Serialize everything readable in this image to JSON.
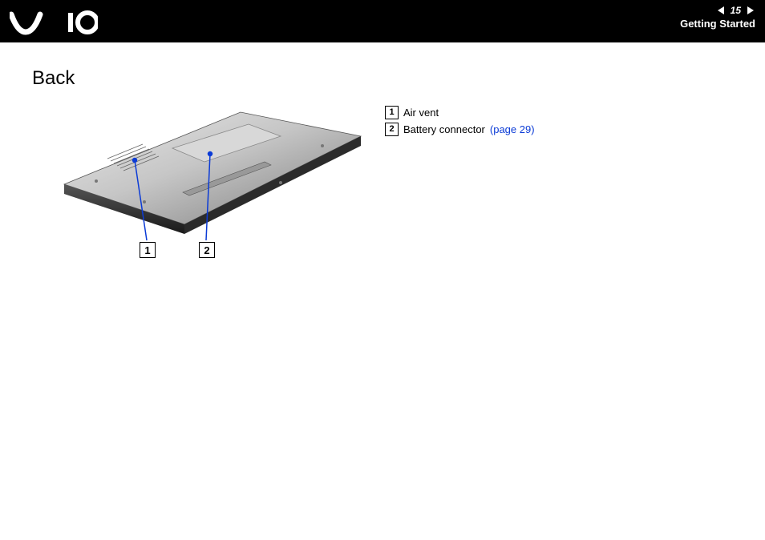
{
  "header": {
    "logo_name": "VAIO",
    "page_number": "15",
    "section": "Getting Started",
    "prev": "◀",
    "next": "▶"
  },
  "page": {
    "title": "Back"
  },
  "illustration": {
    "alt": "Underside of laptop showing callouts",
    "callouts": [
      "1",
      "2"
    ]
  },
  "legend": [
    {
      "num": "1",
      "label": "Air vent",
      "page_ref": ""
    },
    {
      "num": "2",
      "label": "Battery connector",
      "page_ref": "(page 29)"
    }
  ]
}
